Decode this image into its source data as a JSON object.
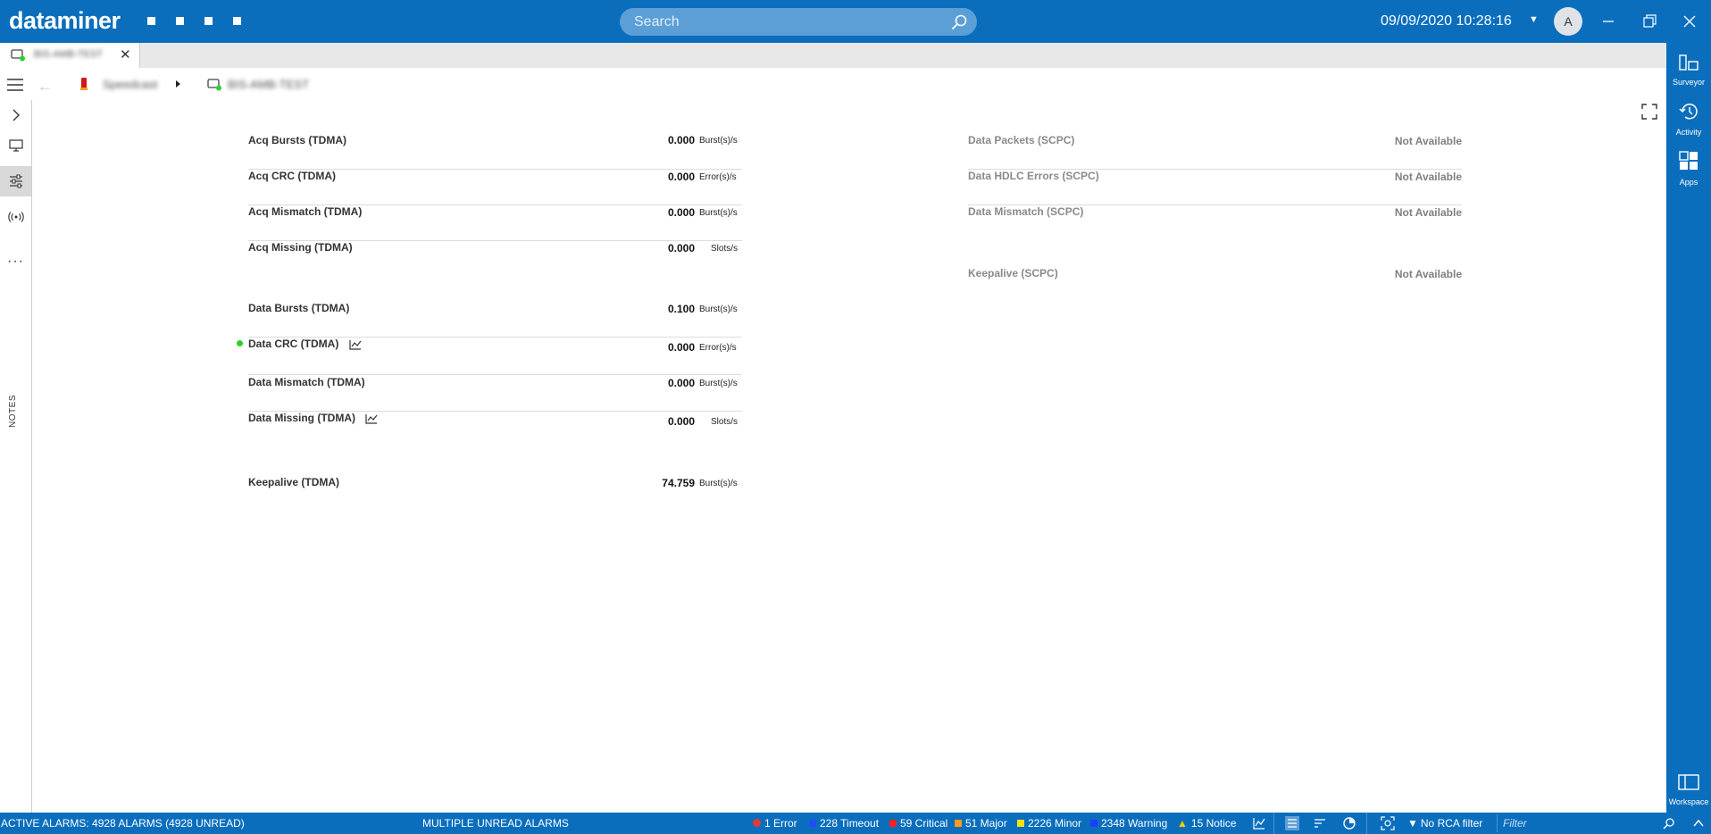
{
  "app": {
    "logo": "dataminer",
    "search_placeholder": "Search",
    "datetime": "09/09/2020 10:28:16",
    "user_initial": "A"
  },
  "tab": {
    "title": "BIS-AMB-TEST"
  },
  "breadcrumb": {
    "item1": "Speedcast",
    "item2": "BIS-AMB-TEST"
  },
  "left_rail": {
    "notes_label": "NOTES"
  },
  "right_rail": {
    "surveyor": "Surveyor",
    "activity": "Activity",
    "apps": "Apps",
    "workspace": "Workspace"
  },
  "tdma_parameters": [
    {
      "name": "Acq Bursts (TDMA)",
      "value": "0.000",
      "unit": "Burst(s)/s"
    },
    {
      "name": "Acq CRC (TDMA)",
      "value": "0.000",
      "unit": "Error(s)/s"
    },
    {
      "name": "Acq Mismatch (TDMA)",
      "value": "0.000",
      "unit": "Burst(s)/s"
    },
    {
      "name": "Acq Missing (TDMA)",
      "value": "0.000",
      "unit": "Slots/s"
    },
    {
      "name": "Data Bursts (TDMA)",
      "value": "0.100",
      "unit": "Burst(s)/s"
    },
    {
      "name": "Data CRC (TDMA)",
      "value": "0.000",
      "unit": "Error(s)/s"
    },
    {
      "name": "Data Mismatch (TDMA)",
      "value": "0.000",
      "unit": "Burst(s)/s"
    },
    {
      "name": "Data Missing (TDMA)",
      "value": "0.000",
      "unit": "Slots/s"
    },
    {
      "name": "Keepalive (TDMA)",
      "value": "74.759",
      "unit": "Burst(s)/s"
    }
  ],
  "scpc_parameters": [
    {
      "name": "Data Packets (SCPC)",
      "value": "Not Available"
    },
    {
      "name": "Data HDLC Errors (SCPC)",
      "value": "Not Available"
    },
    {
      "name": "Data Mismatch (SCPC)",
      "value": "Not Available"
    },
    {
      "name": "Keepalive (SCPC)",
      "value": "Not Available"
    }
  ],
  "status_bar": {
    "active_alarms": "ACTIVE ALARMS: 4928 ALARMS (4928 UNREAD)",
    "unread_notice": "MULTIPLE UNREAD ALARMS",
    "error": "1 Error",
    "timeout": "228 Timeout",
    "critical": "59 Critical",
    "major": "51 Major",
    "minor": "2226 Minor",
    "warning": "2348 Warning",
    "notice": "15 Notice",
    "rca_filter": "No RCA filter",
    "filter_placeholder": "Filter"
  },
  "colors": {
    "brand_blue": "#0a6ebd",
    "error_red": "#e53935",
    "timeout_blue": "#1e4fff",
    "critical_red": "#ff2020",
    "major_orange": "#ff9a1f",
    "minor_yellow": "#f5e400",
    "warning_blue": "#1b3fff",
    "notice_yellow": "#f5d000",
    "ok_green": "#2bd12b"
  }
}
